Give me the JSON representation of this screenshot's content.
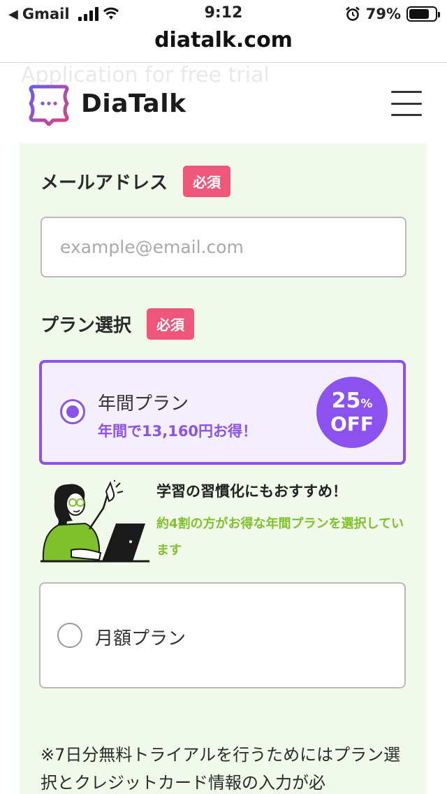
{
  "status_bar": {
    "back_app": "Gmail",
    "time": "9:12",
    "battery": "79%",
    "battery_level": 0.79,
    "icons": [
      "back-arrow-icon",
      "cellular-signal-icon",
      "wifi-icon",
      "alarm-icon",
      "battery-icon"
    ]
  },
  "browser": {
    "url": "diatalk.com"
  },
  "header": {
    "ghost_text": "Application for free trial",
    "logo_text": "DiaTalk",
    "brand_colors": [
      "#6a5cf0",
      "#e0407a"
    ]
  },
  "form": {
    "background": "#f1f9ea",
    "email": {
      "label": "メールアドレス",
      "required_badge": "必須",
      "placeholder": "example@email.com",
      "value": ""
    },
    "plan": {
      "label": "プラン選択",
      "required_badge": "必須",
      "annual": {
        "name": "年間プラン",
        "savings": "年間で13,160円お得！",
        "discount_pct": "25",
        "discount_unit": "%",
        "discount_off": "OFF",
        "selected": true
      },
      "promo": {
        "title": "学習の習慣化にもおすすめ！",
        "text": "約4割の方がお得な年間プランを選択しています"
      },
      "monthly": {
        "name": "月額プラン",
        "selected": false
      }
    },
    "note": "※7日分無料トライアルを行うためにはプラン選択とクレジットカード情報の入力が必"
  },
  "colors": {
    "accent_purple": "#8c52ef",
    "required_pink": "#ef567a",
    "promo_green": "#7ec12a"
  }
}
